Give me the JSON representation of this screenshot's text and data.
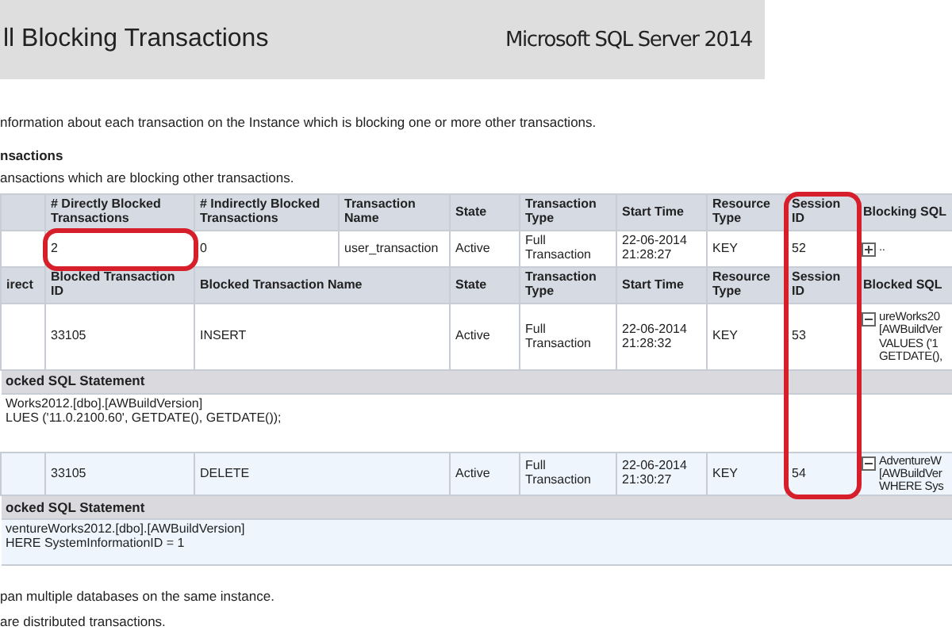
{
  "header": {
    "title": "ll Blocking Transactions",
    "product": "Microsoft SQL Server 2014"
  },
  "description": "nformation about each transaction on the Instance which is blocking one or more other transactions.",
  "section": {
    "title": "nsactions",
    "subtitle": "ansactions which are blocking other transactions."
  },
  "blocking_table": {
    "columns": [
      {
        "label": "# Directly Blocked Transactions",
        "circled": false
      },
      {
        "label": "# Indirectly Blocked Transactions",
        "circled": false
      },
      {
        "label": "Transaction Name",
        "circled": false
      },
      {
        "label": "State",
        "circled": false
      },
      {
        "label": "Transaction Type",
        "circled": false
      },
      {
        "label": "Start Time",
        "circled": false
      },
      {
        "label": "Resource Type",
        "circled": false
      },
      {
        "label": "Session ID",
        "circled": true
      },
      {
        "label": "Blocking SQL",
        "circled": false
      }
    ],
    "row": {
      "cells": [
        {
          "text": "2",
          "circled": true
        },
        {
          "text": "0",
          "circled": false
        },
        {
          "text": "user_transaction",
          "circled": false
        },
        {
          "text": "Active",
          "circled": false
        },
        {
          "text": "Full Transaction",
          "circled": false
        },
        {
          "text": "22-06-2014 21:28:27",
          "circled": false
        },
        {
          "text": "KEY",
          "circled": false
        },
        {
          "text": "52",
          "circled": false
        }
      ],
      "expanded": false,
      "sql_lines": [
        ".."
      ]
    }
  },
  "blocked_table": {
    "columns": [
      "irect",
      "Blocked Transaction ID",
      "Blocked Transaction Name",
      "State",
      "Transaction Type",
      "Start Time",
      "Resource Type",
      "Session ID",
      "Blocked SQL"
    ],
    "rows": [
      {
        "cells": [
          "",
          "33105",
          "INSERT",
          "Active",
          "Full Transaction",
          "22-06-2014 21:28:32",
          "KEY",
          "53"
        ],
        "expanded": true,
        "sql_lines": [
          "ureWorks20",
          "[AWBuildVer",
          "VALUES ('1",
          "GETDATE(),"
        ],
        "statement_label": "ocked SQL Statement",
        "statement_lines": [
          "Works2012.[dbo].[AWBuildVersion]",
          "LUES ('11.0.2100.60', GETDATE(), GETDATE());"
        ]
      },
      {
        "cells": [
          "",
          "33105",
          "DELETE",
          "Active",
          "Full Transaction",
          "22-06-2014 21:30:27",
          "KEY",
          "54"
        ],
        "expanded": true,
        "sql_lines": [
          "AdventureW",
          "[AWBuildVer",
          "WHERE Sys"
        ],
        "statement_label": "ocked SQL Statement",
        "statement_lines": [
          "ventureWorks2012.[dbo].[AWBuildVersion]",
          "HERE SystemInformationID = 1"
        ]
      }
    ]
  },
  "notes": [
    "pan multiple databases on the same instance.",
    "are distributed transactions."
  ]
}
